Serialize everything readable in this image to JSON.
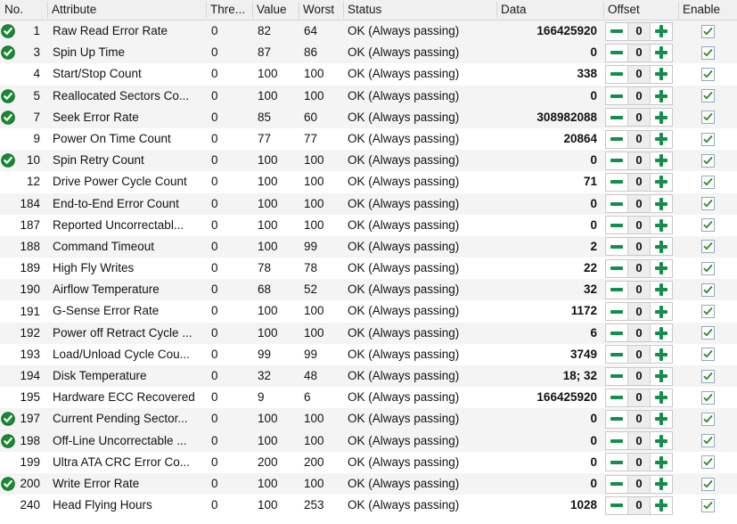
{
  "table": {
    "columns": [
      {
        "key": "no",
        "label": "No."
      },
      {
        "key": "attr",
        "label": "Attribute"
      },
      {
        "key": "thresh",
        "label": "Thre..."
      },
      {
        "key": "value",
        "label": "Value"
      },
      {
        "key": "worst",
        "label": "Worst"
      },
      {
        "key": "status",
        "label": "Status"
      },
      {
        "key": "data",
        "label": "Data"
      },
      {
        "key": "offset",
        "label": "Offset"
      },
      {
        "key": "enable",
        "label": "Enable"
      }
    ],
    "colors": {
      "ok_icon": "#1a8a33",
      "plus_minus": "#148f4b",
      "check": "#2f8f2f",
      "header_bg": "#f0f0f0",
      "row_alt_bg": "#f4f4f4",
      "row_bg": "#ffffff"
    },
    "offset_controls": {
      "decrement_label": "-",
      "increment_label": "+"
    },
    "rows": [
      {
        "icon": "ok-circle-icon",
        "no": "1",
        "attr": "Raw Read Error Rate",
        "thresh": "0",
        "value": "82",
        "worst": "64",
        "status": "OK (Always passing)",
        "data": "166425920",
        "offset": "0",
        "enable": true
      },
      {
        "icon": "ok-circle-icon",
        "no": "3",
        "attr": "Spin Up Time",
        "thresh": "0",
        "value": "87",
        "worst": "86",
        "status": "OK (Always passing)",
        "data": "0",
        "offset": "0",
        "enable": true
      },
      {
        "icon": null,
        "no": "4",
        "attr": "Start/Stop Count",
        "thresh": "0",
        "value": "100",
        "worst": "100",
        "status": "OK (Always passing)",
        "data": "338",
        "offset": "0",
        "enable": true
      },
      {
        "icon": "ok-circle-icon",
        "no": "5",
        "attr": "Reallocated Sectors Co...",
        "thresh": "0",
        "value": "100",
        "worst": "100",
        "status": "OK (Always passing)",
        "data": "0",
        "offset": "0",
        "enable": true
      },
      {
        "icon": "ok-circle-icon",
        "no": "7",
        "attr": "Seek Error Rate",
        "thresh": "0",
        "value": "85",
        "worst": "60",
        "status": "OK (Always passing)",
        "data": "308982088",
        "offset": "0",
        "enable": true
      },
      {
        "icon": null,
        "no": "9",
        "attr": "Power On Time Count",
        "thresh": "0",
        "value": "77",
        "worst": "77",
        "status": "OK (Always passing)",
        "data": "20864",
        "offset": "0",
        "enable": true
      },
      {
        "icon": "ok-circle-icon",
        "no": "10",
        "attr": "Spin Retry Count",
        "thresh": "0",
        "value": "100",
        "worst": "100",
        "status": "OK (Always passing)",
        "data": "0",
        "offset": "0",
        "enable": true
      },
      {
        "icon": null,
        "no": "12",
        "attr": "Drive Power Cycle Count",
        "thresh": "0",
        "value": "100",
        "worst": "100",
        "status": "OK (Always passing)",
        "data": "71",
        "offset": "0",
        "enable": true
      },
      {
        "icon": null,
        "no": "184",
        "attr": "End-to-End Error Count",
        "thresh": "0",
        "value": "100",
        "worst": "100",
        "status": "OK (Always passing)",
        "data": "0",
        "offset": "0",
        "enable": true
      },
      {
        "icon": null,
        "no": "187",
        "attr": "Reported Uncorrectabl...",
        "thresh": "0",
        "value": "100",
        "worst": "100",
        "status": "OK (Always passing)",
        "data": "0",
        "offset": "0",
        "enable": true
      },
      {
        "icon": null,
        "no": "188",
        "attr": "Command Timeout",
        "thresh": "0",
        "value": "100",
        "worst": "99",
        "status": "OK (Always passing)",
        "data": "2",
        "offset": "0",
        "enable": true
      },
      {
        "icon": null,
        "no": "189",
        "attr": "High Fly Writes",
        "thresh": "0",
        "value": "78",
        "worst": "78",
        "status": "OK (Always passing)",
        "data": "22",
        "offset": "0",
        "enable": true
      },
      {
        "icon": null,
        "no": "190",
        "attr": "Airflow Temperature",
        "thresh": "0",
        "value": "68",
        "worst": "52",
        "status": "OK (Always passing)",
        "data": "32",
        "offset": "0",
        "enable": true
      },
      {
        "icon": null,
        "no": "191",
        "attr": "G-Sense Error Rate",
        "thresh": "0",
        "value": "100",
        "worst": "100",
        "status": "OK (Always passing)",
        "data": "1172",
        "offset": "0",
        "enable": true
      },
      {
        "icon": null,
        "no": "192",
        "attr": "Power off Retract Cycle ...",
        "thresh": "0",
        "value": "100",
        "worst": "100",
        "status": "OK (Always passing)",
        "data": "6",
        "offset": "0",
        "enable": true
      },
      {
        "icon": null,
        "no": "193",
        "attr": "Load/Unload Cycle Cou...",
        "thresh": "0",
        "value": "99",
        "worst": "99",
        "status": "OK (Always passing)",
        "data": "3749",
        "offset": "0",
        "enable": true
      },
      {
        "icon": null,
        "no": "194",
        "attr": "Disk Temperature",
        "thresh": "0",
        "value": "32",
        "worst": "48",
        "status": "OK (Always passing)",
        "data": "18; 32",
        "offset": "0",
        "enable": true
      },
      {
        "icon": null,
        "no": "195",
        "attr": "Hardware ECC Recovered",
        "thresh": "0",
        "value": "9",
        "worst": "6",
        "status": "OK (Always passing)",
        "data": "166425920",
        "offset": "0",
        "enable": true
      },
      {
        "icon": "ok-circle-icon",
        "no": "197",
        "attr": "Current Pending Sector...",
        "thresh": "0",
        "value": "100",
        "worst": "100",
        "status": "OK (Always passing)",
        "data": "0",
        "offset": "0",
        "enable": true
      },
      {
        "icon": "ok-circle-icon",
        "no": "198",
        "attr": "Off-Line Uncorrectable ...",
        "thresh": "0",
        "value": "100",
        "worst": "100",
        "status": "OK (Always passing)",
        "data": "0",
        "offset": "0",
        "enable": true
      },
      {
        "icon": null,
        "no": "199",
        "attr": "Ultra ATA CRC Error Co...",
        "thresh": "0",
        "value": "200",
        "worst": "200",
        "status": "OK (Always passing)",
        "data": "0",
        "offset": "0",
        "enable": true
      },
      {
        "icon": "ok-circle-icon",
        "no": "200",
        "attr": "Write Error Rate",
        "thresh": "0",
        "value": "100",
        "worst": "100",
        "status": "OK (Always passing)",
        "data": "0",
        "offset": "0",
        "enable": true
      },
      {
        "icon": null,
        "no": "240",
        "attr": "Head Flying Hours",
        "thresh": "0",
        "value": "100",
        "worst": "253",
        "status": "OK (Always passing)",
        "data": "1028",
        "offset": "0",
        "enable": true
      }
    ]
  }
}
